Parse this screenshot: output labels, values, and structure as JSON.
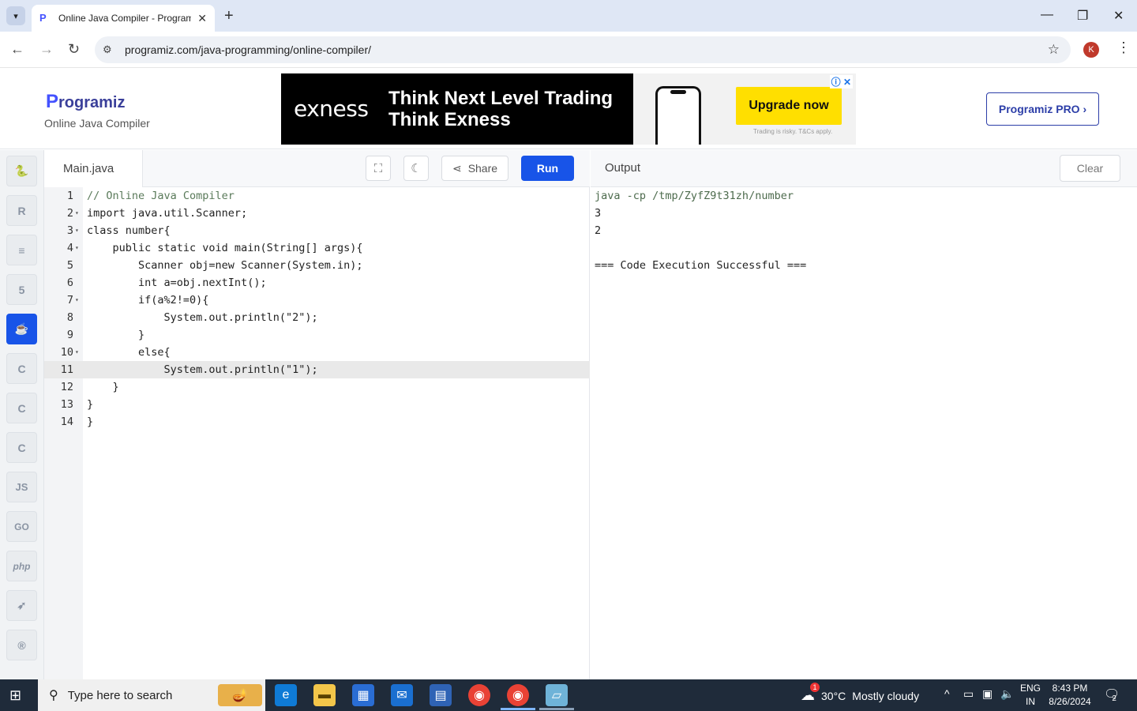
{
  "browser": {
    "tab_title": "Online Java Compiler - Programiz",
    "url": "programiz.com/java-programming/online-compiler/",
    "profile_initial": "K"
  },
  "site": {
    "logo_text": "rogramiz",
    "logo_letter": "P",
    "subtitle": "Online Java Compiler",
    "pro_button": "Programiz PRO ›"
  },
  "ad": {
    "brand": "exness",
    "headline_1": "Think Next Level Trading",
    "headline_2": "Think Exness",
    "cta": "Upgrade now",
    "disclaimer": "Trading is risky. T&Cs apply."
  },
  "languages": [
    "python",
    "r",
    "sql",
    "html",
    "java",
    "c",
    "cpp",
    "csharp",
    "js",
    "go",
    "php",
    "swift",
    "rust"
  ],
  "editor": {
    "file_name": "Main.java",
    "share_label": "Share",
    "run_label": "Run",
    "active_line": 11,
    "lines": [
      {
        "n": "1",
        "fold": false,
        "text": "// Online Java Compiler"
      },
      {
        "n": "2",
        "fold": true,
        "text": "import java.util.Scanner;"
      },
      {
        "n": "3",
        "fold": true,
        "text": "class number{"
      },
      {
        "n": "4",
        "fold": true,
        "text": "    public static void main(String[] args){"
      },
      {
        "n": "5",
        "fold": false,
        "text": "        Scanner obj=new Scanner(System.in);"
      },
      {
        "n": "6",
        "fold": false,
        "text": "        int a=obj.nextInt();"
      },
      {
        "n": "7",
        "fold": true,
        "text": "        if(a%2!=0){"
      },
      {
        "n": "8",
        "fold": false,
        "text": "            System.out.println(\"2\");"
      },
      {
        "n": "9",
        "fold": false,
        "text": "        }"
      },
      {
        "n": "10",
        "fold": true,
        "text": "        else{"
      },
      {
        "n": "11",
        "fold": false,
        "text": "            System.out.println(\"1\");"
      },
      {
        "n": "12",
        "fold": false,
        "text": "    }"
      },
      {
        "n": "13",
        "fold": false,
        "text": "}"
      },
      {
        "n": "14",
        "fold": false,
        "text": "}"
      }
    ]
  },
  "output": {
    "title": "Output",
    "clear_label": "Clear",
    "lines": [
      {
        "text": "java -cp /tmp/ZyfZ9t31zh/number",
        "kind": "cmd"
      },
      {
        "text": "3",
        "kind": "out"
      },
      {
        "text": "2",
        "kind": "out"
      },
      {
        "text": "",
        "kind": "out"
      },
      {
        "text": "=== Code Execution Successful ===",
        "kind": "out"
      }
    ]
  },
  "taskbar": {
    "search_placeholder": "Type here to search",
    "weather_temp": "30°C",
    "weather_text": "Mostly cloudy",
    "weather_badge": "1",
    "lang_1": "ENG",
    "lang_2": "IN",
    "time": "8:43 PM",
    "date": "8/26/2024",
    "notif_count": "2"
  }
}
